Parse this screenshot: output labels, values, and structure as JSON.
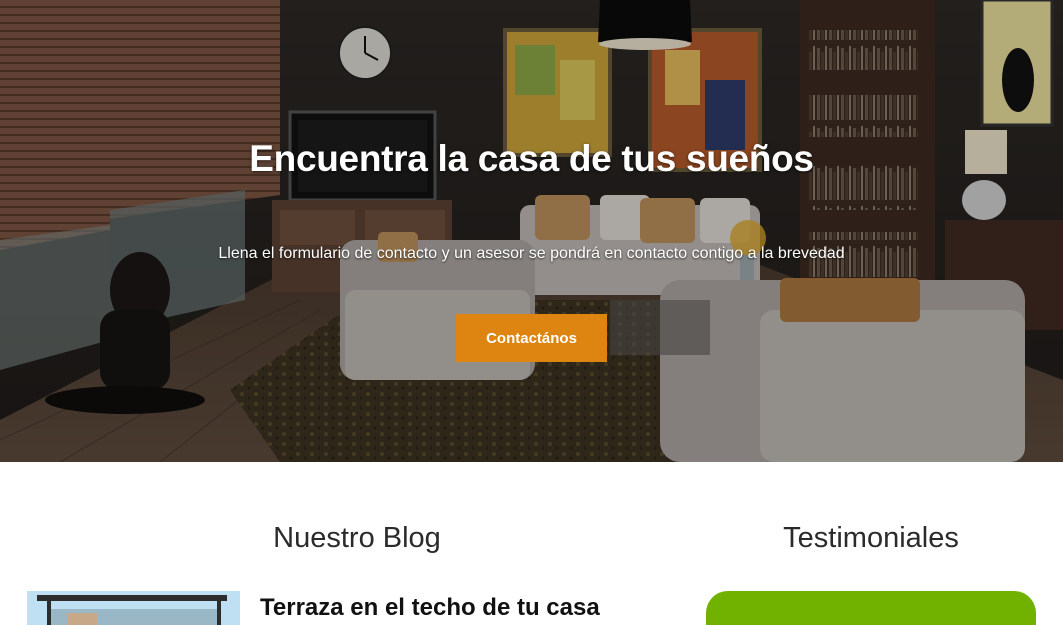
{
  "hero": {
    "title": "Encuentra la casa de tus sueños",
    "subtitle": "Llena el formulario de contacto y un asesor se pondrá en contacto contigo a la brevedad",
    "cta_label": "Contactános",
    "accent_color": "#de8410"
  },
  "blog": {
    "heading": "Nuestro Blog",
    "posts": [
      {
        "title": "Terraza en el techo de tu casa"
      }
    ]
  },
  "testimonials": {
    "heading": "Testimoniales",
    "card_color": "#71b100"
  }
}
